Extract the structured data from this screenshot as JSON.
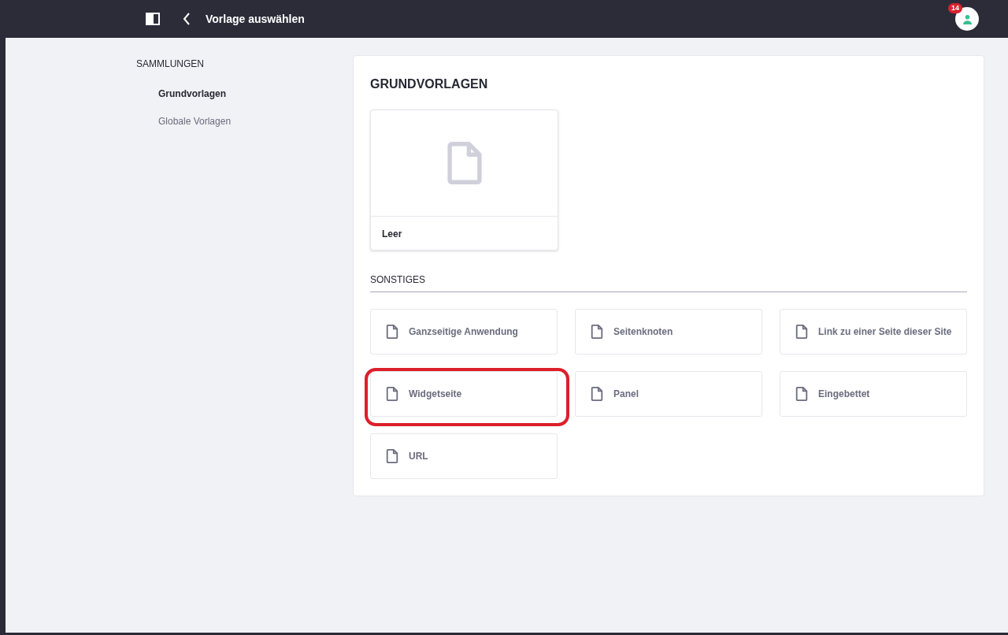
{
  "header": {
    "title": "Vorlage auswählen",
    "notification_count": "14"
  },
  "sidebar": {
    "heading": "SAMMLUNGEN",
    "items": [
      {
        "label": "Grundvorlagen",
        "selected": true
      },
      {
        "label": "Globale Vorlagen",
        "selected": false
      }
    ]
  },
  "main": {
    "title": "GRUNDVORLAGEN",
    "basic_templates": [
      {
        "label": "Leer"
      }
    ],
    "other_heading": "SONSTIGES",
    "other_templates": [
      {
        "label": "Ganzseitige Anwendung",
        "highlighted": false
      },
      {
        "label": "Seitenknoten",
        "highlighted": false
      },
      {
        "label": "Link zu einer Seite dieser Site",
        "highlighted": false
      },
      {
        "label": "Widgetseite",
        "highlighted": true
      },
      {
        "label": "Panel",
        "highlighted": false
      },
      {
        "label": "Eingebettet",
        "highlighted": false
      },
      {
        "label": "URL",
        "highlighted": false
      }
    ]
  }
}
